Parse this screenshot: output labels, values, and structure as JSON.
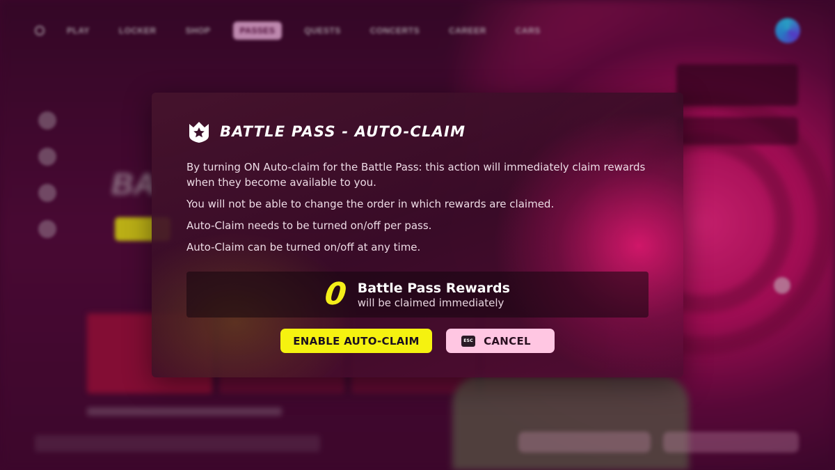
{
  "background": {
    "nav_items": [
      "PLAY",
      "LOCKER",
      "SHOP",
      "PASSES",
      "QUESTS",
      "CONCERTS",
      "CAREER",
      "CARS"
    ],
    "active_nav": "PASSES",
    "hero_title": "BA"
  },
  "modal": {
    "title": "BATTLE PASS - AUTO-CLAIM",
    "icon": "battle-pass-star-icon",
    "paragraphs": [
      "By turning ON Auto-claim for the Battle Pass: this action will immediately claim rewards when they become available to you.",
      "You will not be able to change the order in which rewards are claimed.",
      "Auto-Claim needs to be turned on/off per pass.",
      "Auto-Claim can be turned on/off at any time."
    ],
    "rewards": {
      "count": "0",
      "label": "Battle Pass Rewards",
      "sublabel": "will be claimed immediately"
    },
    "buttons": {
      "enable": "ENABLE AUTO-CLAIM",
      "cancel": "CANCEL",
      "esc_key": "ESC"
    }
  },
  "colors": {
    "accent_yellow": "#f5f210",
    "cancel_pink": "#ffc6e2",
    "bg_magenta": "#d0126a"
  }
}
